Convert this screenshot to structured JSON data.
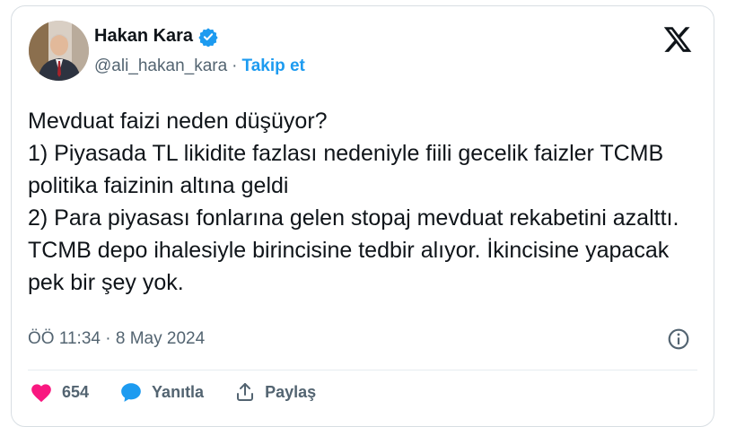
{
  "author": {
    "name": "Hakan Kara",
    "handle": "@ali_hakan_kara",
    "separator": "·",
    "follow_label": "Takip et"
  },
  "icons": {
    "verified": "verified-badge-icon",
    "logo": "x-logo-icon",
    "info": "info-icon",
    "like": "heart-icon",
    "reply": "speech-bubble-icon",
    "share": "share-icon"
  },
  "colors": {
    "accent": "#1d9bf0",
    "like": "#f91880",
    "text": "#0f1419",
    "muted": "#536471"
  },
  "tweet": {
    "text": "Mevduat faizi neden düşüyor?\n1) Piyasada TL likidite fazlası nedeniyle fiili gecelik faizler TCMB politika faizinin altına geldi\n2) Para piyasası fonlarına gelen stopaj mevduat rekabetini azalttı.\nTCMB depo ihalesiyle birincisine tedbir alıyor. İkincisine yapacak pek bir şey yok.",
    "timestamp": "ÖÖ 11:34 · 8 May 2024"
  },
  "actions": {
    "like_count": "654",
    "reply_label": "Yanıtla",
    "share_label": "Paylaş"
  }
}
